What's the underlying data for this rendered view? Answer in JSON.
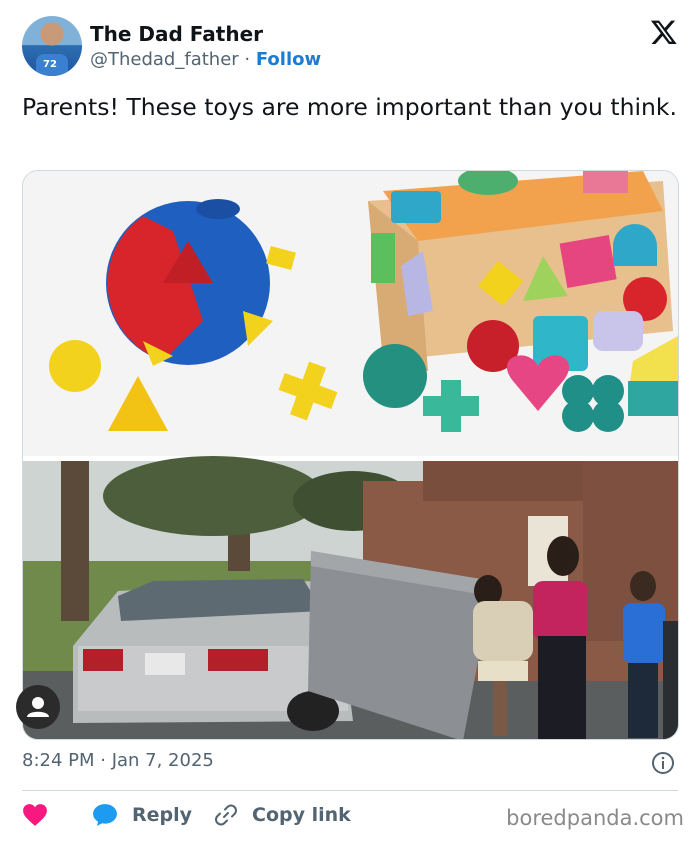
{
  "author": {
    "display_name": "The Dad Father",
    "handle": "@Thedad_father",
    "separator": " · ",
    "follow_label": "Follow",
    "avatar_jersey_number": "72"
  },
  "tweet": {
    "text": "Parents! These toys are more important than you think.",
    "timestamp": "8:24 PM · Jan 7, 2025"
  },
  "actions": {
    "reply_label": "Reply",
    "copy_link_label": "Copy link"
  },
  "watermark": "boredpanda.com",
  "colors": {
    "follow": "#1d7bd0",
    "heart": "#f91880",
    "reply_bubble": "#1d9bf0",
    "muted": "#536471"
  },
  "icons": [
    "x-logo-icon",
    "info-icon",
    "heart-icon",
    "reply-bubble-icon",
    "link-icon",
    "user-icon"
  ]
}
